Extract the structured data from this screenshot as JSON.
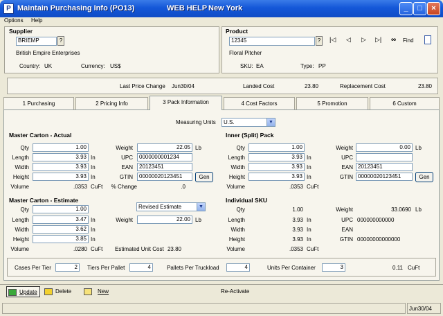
{
  "title": {
    "app": "Maintain Purchasing Info (PO13)",
    "help": "WEB HELP",
    "location": "New York"
  },
  "menu": [
    "Options",
    "Help"
  ],
  "supplier": {
    "heading": "Supplier",
    "code": "BRIEMP",
    "name": "British Empire Enterprises",
    "country_label": "Country:",
    "country": "UK",
    "currency_label": "Currency:",
    "currency": "US$"
  },
  "product": {
    "heading": "Product",
    "code": "12345",
    "find_label": "Find",
    "name": "Floral Pitcher",
    "sku_label": "SKU:",
    "sku": "EA",
    "type_label": "Type:",
    "type": "PP"
  },
  "price": {
    "last_change_label": "Last Price Change",
    "last_change": "Jun30/04",
    "landed_label": "Landed Cost",
    "landed": "23.80",
    "replacement_label": "Replacement Cost",
    "replacement": "23.80"
  },
  "tabs": [
    "1 Purchasing",
    "2 Pricing Info",
    "3 Pack Information",
    "4 Cost Factors",
    "5 Promotion",
    "6 Custom"
  ],
  "measuring": {
    "label": "Measuring Units",
    "value": "U.S."
  },
  "mca": {
    "heading": "Master Carton - Actual",
    "qty_label": "Qty",
    "qty": "1.00",
    "length_label": "Length",
    "length": "3.93",
    "width_label": "Width",
    "width": "3.93",
    "height_label": "Height",
    "height": "3.93",
    "volume_label": "Volume",
    "volume": ".0353",
    "in": "In",
    "cuft": "CuFt",
    "weight_label": "Weight",
    "weight": "22.05",
    "lb": "Lb",
    "upc_label": "UPC",
    "upc": "0000000001234",
    "ean_label": "EAN",
    "ean": "20123451",
    "gtin_label": "GTIN",
    "gtin": "00000020123451",
    "gen": "Gen",
    "pct_label": "% Change",
    "pct": ".0"
  },
  "inner": {
    "heading": "Inner (Split) Pack",
    "qty_label": "Qty",
    "qty": "1.00",
    "length_label": "Length",
    "length": "3.93",
    "width_label": "Width",
    "width": "3.93",
    "height_label": "Height",
    "height": "3.93",
    "volume_label": "Volume",
    "volume": ".0353",
    "in": "In",
    "cuft": "CuFt",
    "weight_label": "Weight",
    "weight": "0.00",
    "lb": "Lb",
    "upc_label": "UPC",
    "upc": "",
    "ean_label": "EAN",
    "ean": "20123451",
    "gtin_label": "GTIN",
    "gtin": "00000020123451",
    "gen": "Gen"
  },
  "mce": {
    "heading": "Master Carton - Estimate",
    "qty_label": "Qty",
    "qty": "1.00",
    "estimate_select": "Revised Estimate",
    "length_label": "Length",
    "length": "3.47",
    "width_label": "Width",
    "width": "3.62",
    "height_label": "Height",
    "height": "3.85",
    "volume_label": "Volume",
    "volume": ".0280",
    "in": "In",
    "cuft": "CuFt",
    "weight_label": "Weight",
    "weight": "22.00",
    "lb": "Lb",
    "unit_cost_label": "Estimated Unit Cost",
    "unit_cost": "23.80"
  },
  "sku": {
    "heading": "Individual SKU",
    "qty_label": "Qty",
    "qty": "1.00",
    "length_label": "Length",
    "length": "3.93",
    "width_label": "Width",
    "width": "3.93",
    "height_label": "Height",
    "height": "3.93",
    "volume_label": "Volume",
    "volume": ".0353",
    "in": "In",
    "cuft": "CuFt",
    "weight_label": "Weight",
    "weight": "33.0690",
    "lb": "Lb",
    "upc_label": "UPC",
    "upc": "000000000000",
    "ean_label": "EAN",
    "ean": "",
    "gtin_label": "GTIN",
    "gtin": "00000000000000"
  },
  "bottom": {
    "cases_label": "Cases Per Tier",
    "cases": "2",
    "tiers_label": "Tiers Per Pallet",
    "tiers": "4",
    "pallets_label": "Pallets Per Truckload",
    "pallets": "4",
    "units_label": "Units Per Container",
    "units": "3",
    "cuft_value": "0.11",
    "cuft": "CuFt"
  },
  "toolbar": {
    "update": "Update",
    "delete": "Delete",
    "new": "New",
    "reactivate": "Re-Activate"
  },
  "status": {
    "date": "Jun30/04"
  }
}
